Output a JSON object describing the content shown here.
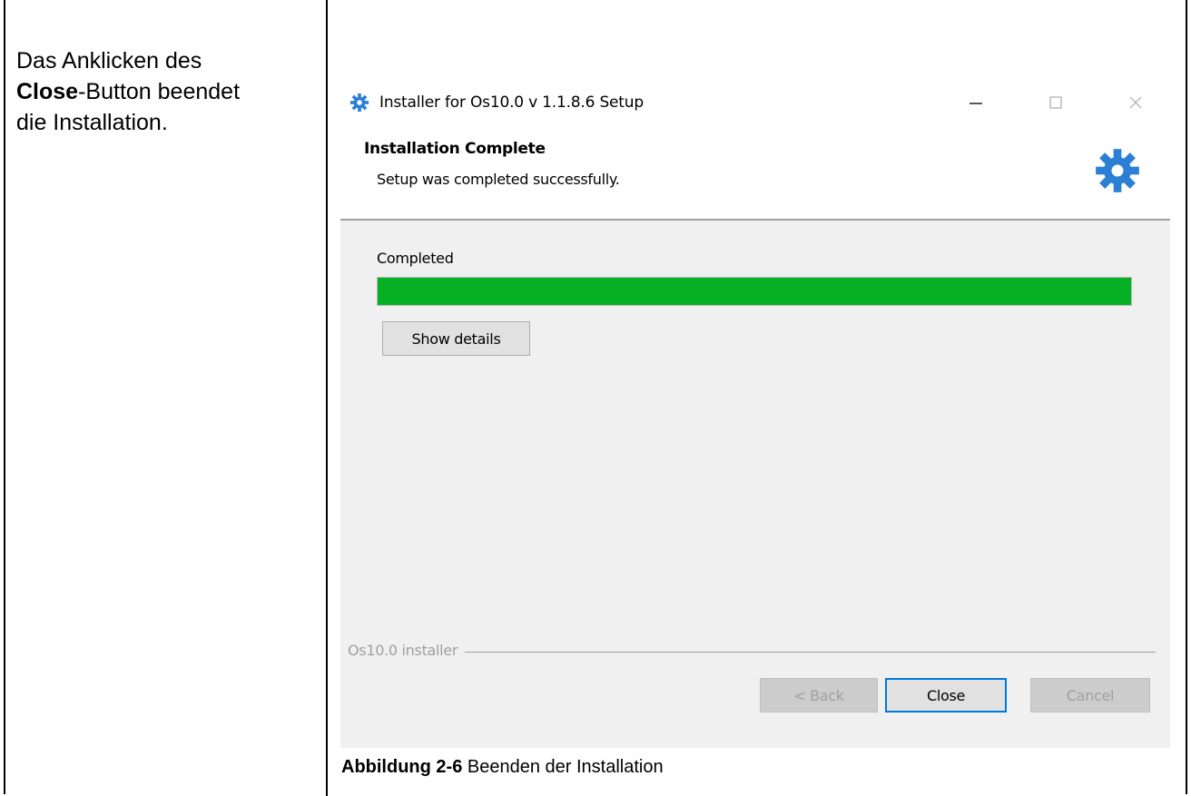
{
  "left_text": {
    "line1": "Das Anklicken des",
    "bold": "Close",
    "line2_rest": "-Button beendet",
    "line3": "die Installation."
  },
  "window": {
    "title": "Installer for Os10.0 v 1.1.8.6 Setup",
    "controls": {
      "minimize": "—",
      "maximize": "☐",
      "close": "✕"
    },
    "header_title": "Installation Complete",
    "header_subtitle": "Setup was completed successfully.",
    "status_label": "Completed",
    "progress_percent": 100,
    "show_details_label": "Show details",
    "group_label": "Os10.0 installer",
    "back_label": "< Back",
    "close_label": "Close",
    "cancel_label": "Cancel",
    "accent_color": "#0078d7",
    "progress_color": "#06b025",
    "icons": {
      "title": "gear-icon",
      "header": "gear-icon"
    }
  },
  "caption": {
    "bold": "Abbildung 2-6",
    "text": " Beenden der Installation"
  }
}
